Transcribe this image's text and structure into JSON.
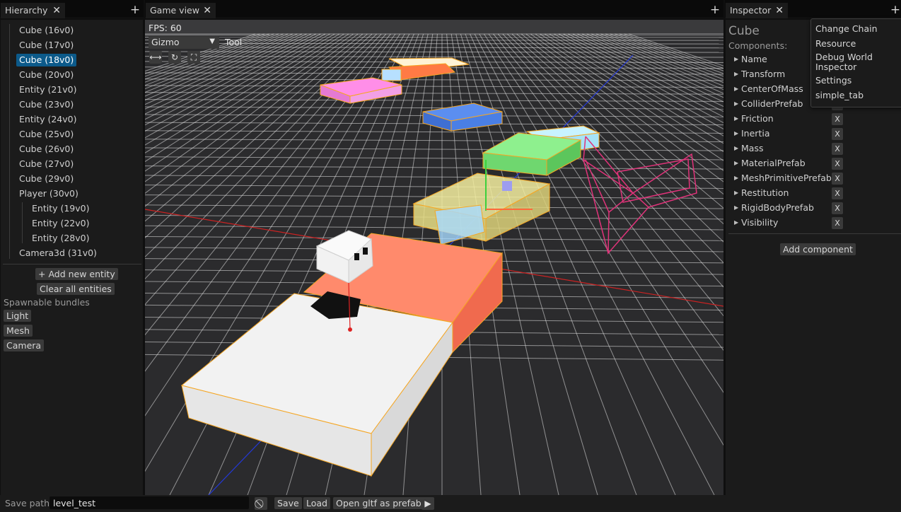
{
  "hierarchy": {
    "tab_label": "Hierarchy",
    "items": [
      {
        "label": "Cube (16v0)"
      },
      {
        "label": "Cube (17v0)"
      },
      {
        "label": "Cube (18v0)"
      },
      {
        "label": "Cube (20v0)"
      },
      {
        "label": "Entity (21v0)"
      },
      {
        "label": "Cube (23v0)"
      },
      {
        "label": "Entity (24v0)"
      },
      {
        "label": "Cube (25v0)"
      },
      {
        "label": "Cube (26v0)"
      },
      {
        "label": "Cube (27v0)"
      },
      {
        "label": "Cube (29v0)"
      },
      {
        "label": "Player (30v0)"
      },
      {
        "label": "Entity (19v0)"
      },
      {
        "label": "Entity (22v0)"
      },
      {
        "label": "Entity (28v0)"
      },
      {
        "label": "Camera3d (31v0)"
      }
    ],
    "add_entity_label": "+ Add new entity",
    "clear_entities_label": "Clear all entities",
    "spawnable_title": "Spawnable bundles",
    "bundles": [
      "Light",
      "Mesh",
      "Camera"
    ]
  },
  "game_view": {
    "tab_label": "Game view",
    "fps_text": "FPS: 60",
    "gizmo_select": "Gizmo",
    "tool_label": "Tool",
    "tool_icons": [
      "translate-icon",
      "rotate-icon",
      "scale-icon"
    ]
  },
  "inspector": {
    "tab_label": "Inspector",
    "entity_name": "Cube",
    "components_label": "Components:",
    "components": [
      "Name",
      "Transform",
      "CenterOfMass",
      "ColliderPrefab",
      "Friction",
      "Inertia",
      "Mass",
      "MaterialPrefab",
      "MeshPrimitivePrefab",
      "Restitution",
      "RigidBodyPrefab",
      "Visibility"
    ],
    "remove_label": "X",
    "add_component_label": "Add component"
  },
  "context_menu": {
    "items": [
      "Change Chain",
      "Resource",
      "Debug World\nInspector",
      "Settings",
      "simple_tab"
    ]
  },
  "bottom_bar": {
    "save_path_label": "Save path:",
    "save_path_value": "level_test",
    "save_label": "Save",
    "load_label": "Load",
    "open_gltf_label": "Open gltf as prefab"
  },
  "colors": {
    "selection": "#0c5a8a",
    "panel": "#1b1b1b",
    "button": "#3a3a3a",
    "viewport_bg": "#2b2b2d",
    "selected_outline": "#f5a623"
  }
}
